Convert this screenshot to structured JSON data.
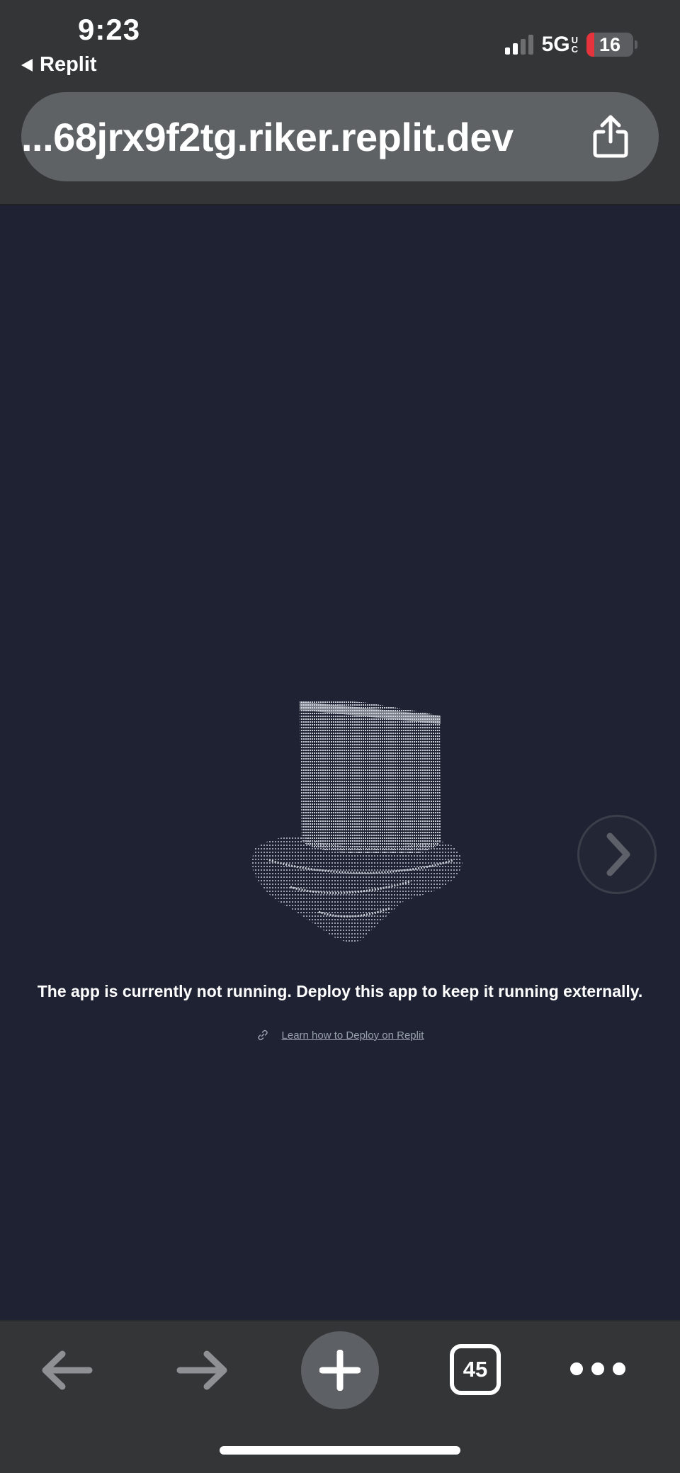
{
  "status_bar": {
    "time": "9:23",
    "back_app": "Replit",
    "network": "5G",
    "network_suffix_top": "U",
    "network_suffix_bottom": "C",
    "battery": "16",
    "battery_level": 0.16,
    "battery_color": "#e5343b"
  },
  "browser": {
    "url": "...68jrx9f2tg.riker.replit.dev",
    "share_icon": "share-icon"
  },
  "page": {
    "message": "The app is currently not running. Deploy this app to keep it running externally.",
    "link_text": "Learn how to Deploy on Replit",
    "link_icon": "link-icon",
    "art": "ascii-art-top-hat",
    "next_icon": "chevron-right-icon",
    "background": "#1e2232"
  },
  "toolbar": {
    "back_icon": "arrow-left-icon",
    "forward_icon": "arrow-right-icon",
    "new_tab_icon": "plus-icon",
    "tab_count": "45",
    "more_icon": "more-dots-icon"
  }
}
